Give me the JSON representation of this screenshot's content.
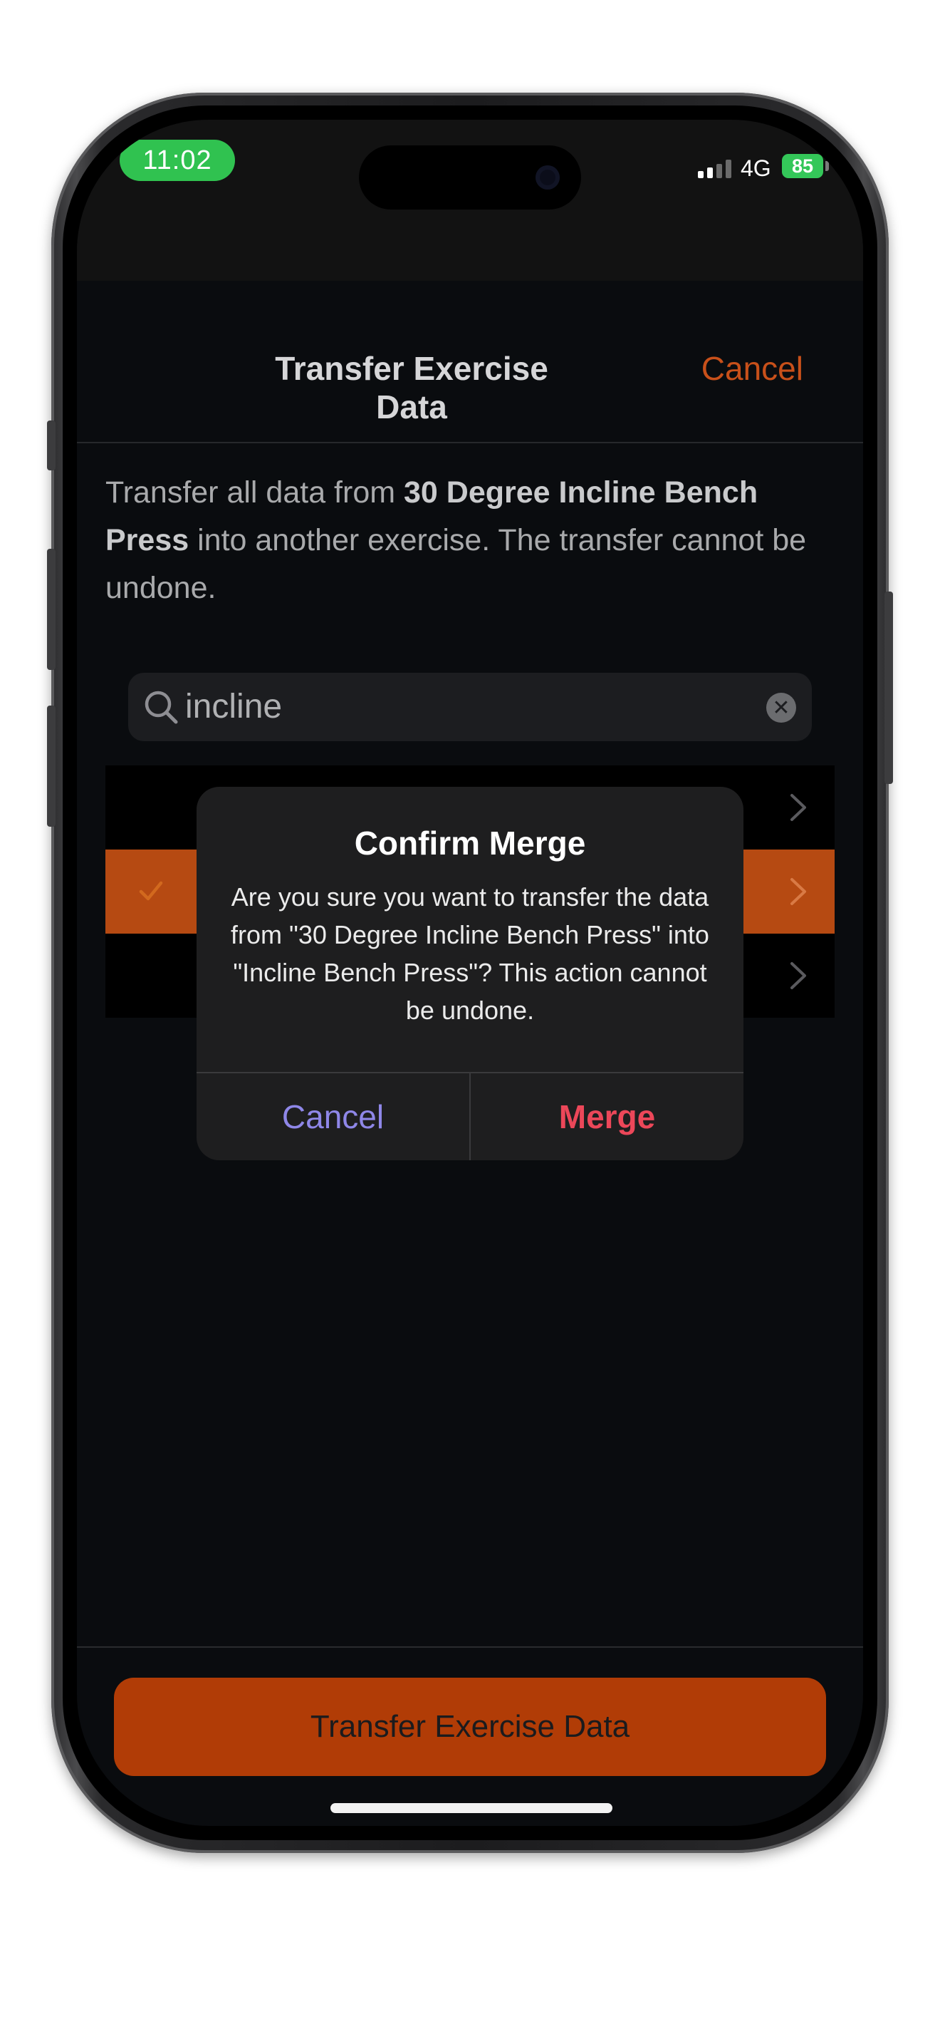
{
  "status_bar": {
    "time": "11:02",
    "network": "4G",
    "battery": "85"
  },
  "nav": {
    "title": "Transfer Exercise Data",
    "cancel_label": "Cancel"
  },
  "description": {
    "prefix": "Transfer all data from ",
    "exercise": "30 Degree Incline Bench Press",
    "suffix": " into another exercise. The transfer cannot be undone."
  },
  "search": {
    "value": "incline",
    "icon": "search-icon",
    "clear_icon": "clear-icon"
  },
  "list": {
    "rows": [
      {
        "selected": false
      },
      {
        "selected": true
      },
      {
        "selected": false
      }
    ]
  },
  "alert": {
    "title": "Confirm Merge",
    "message": "Are you sure you want to transfer the data from \"30 Degree Incline Bench Press\" into \"Incline Bench Press\"? This action cannot be undone.",
    "cancel_label": "Cancel",
    "merge_label": "Merge"
  },
  "bottom": {
    "button_label": "Transfer Exercise Data"
  },
  "colors": {
    "accent": "#c8501a",
    "button_fill": "#b13c06",
    "selected_row": "#b64a12",
    "alert_cancel": "#8f87e8",
    "alert_destructive": "#ec4759"
  }
}
